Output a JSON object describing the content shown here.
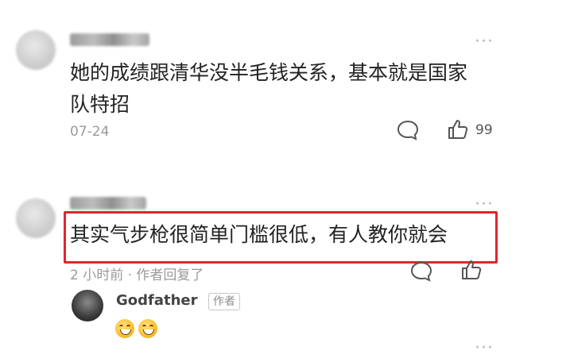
{
  "comments": [
    {
      "text_line1": "她的成绩跟清华没半毛钱关系，基本就是国家",
      "text_line2": "队特招",
      "date": "07-24",
      "like_count": "99"
    },
    {
      "text": "其实气步枪很简单门槛很低，有人教你就会",
      "meta": "2 小时前 · 作者回复了",
      "highlight_color": "#e0262b"
    }
  ],
  "reply": {
    "username": "Godfather",
    "badge": "作者"
  },
  "icons": [
    "more-icon",
    "comment-icon",
    "like-icon"
  ]
}
